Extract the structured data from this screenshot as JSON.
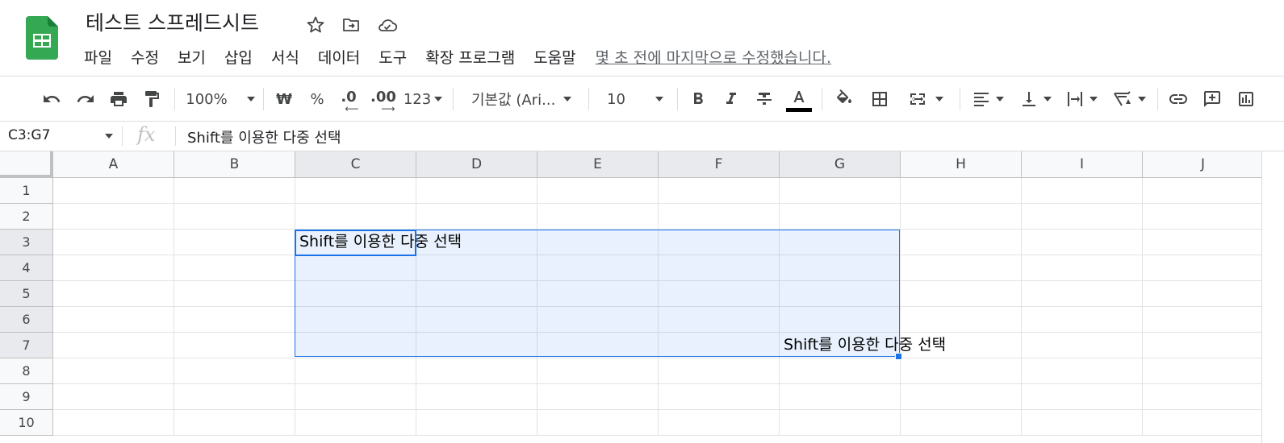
{
  "document": {
    "title": "테스트 스프레드시트",
    "last_edit": "몇 초 전에 마지막으로 수정했습니다."
  },
  "menu": [
    "파일",
    "수정",
    "보기",
    "삽입",
    "서식",
    "데이터",
    "도구",
    "확장 프로그램",
    "도움말"
  ],
  "toolbar": {
    "zoom": "100%",
    "currency": "₩",
    "percent": "%",
    "decimal_decrease": ".0",
    "decimal_increase": ".00",
    "more_formats": "123",
    "font": "기본값 (Ari...",
    "font_size": "10",
    "text_color": "#000000"
  },
  "formula_bar": {
    "name_box": "C3:G7",
    "fx": "fx",
    "value": "Shift를 이용한 다중 선택"
  },
  "grid": {
    "columns": [
      "A",
      "B",
      "C",
      "D",
      "E",
      "F",
      "G",
      "H",
      "I",
      "J"
    ],
    "rows": [
      "1",
      "2",
      "3",
      "4",
      "5",
      "6",
      "7",
      "8",
      "9",
      "10"
    ],
    "selected_columns": [
      "C",
      "D",
      "E",
      "F",
      "G"
    ],
    "selected_rows": [
      "3",
      "4",
      "5",
      "6",
      "7"
    ],
    "cells": {
      "C3": "Shift를 이용한 다중 선택",
      "G7": "Shift를 이용한 다중 선택"
    }
  },
  "colors": {
    "brand_green": "#0f9d58",
    "selection_blue": "#1a73e8"
  }
}
